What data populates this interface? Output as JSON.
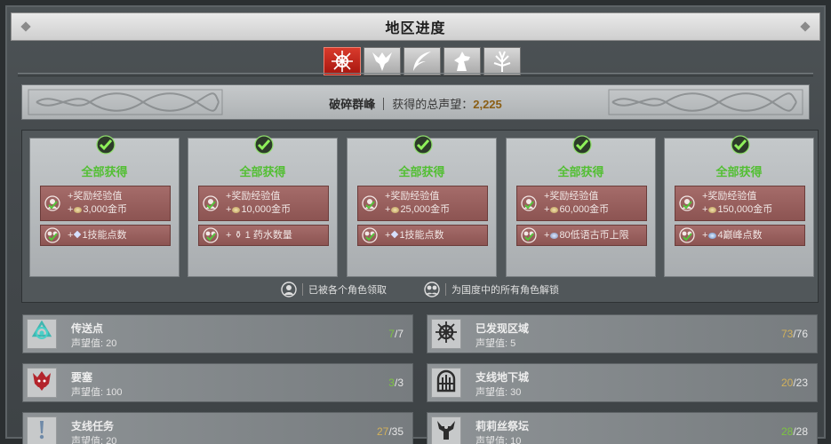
{
  "window": {
    "title": "地区进度"
  },
  "tabs": [
    {
      "icon": "sun-cross-icon",
      "active": true
    },
    {
      "icon": "dragon-head-icon",
      "active": false
    },
    {
      "icon": "feather-icon",
      "active": false
    },
    {
      "icon": "horse-icon",
      "active": false
    },
    {
      "icon": "tree-icon",
      "active": false
    }
  ],
  "header": {
    "region": "破碎群峰",
    "label": "获得的总声望：",
    "amount": "2,225"
  },
  "reward_tiers": [
    {
      "status": "全部获得",
      "xp_line": "+奖励经验值",
      "gold_plus": "+",
      "gold": "3,000金币",
      "extra_plus": "+",
      "extra": "1技能点数",
      "extra_icon": "skill"
    },
    {
      "status": "全部获得",
      "xp_line": "+奖励经验值",
      "gold_plus": "+",
      "gold": "10,000金币",
      "extra_plus": "+",
      "extra": "1 药水数量",
      "extra_icon": "potion"
    },
    {
      "status": "全部获得",
      "xp_line": "+奖励经验值",
      "gold_plus": "+",
      "gold": "25,000金币",
      "extra_plus": "+",
      "extra": "1技能点数",
      "extra_icon": "skill"
    },
    {
      "status": "全部获得",
      "xp_line": "+奖励经验值",
      "gold_plus": "+",
      "gold": "60,000金币",
      "extra_plus": "+",
      "extra": "80低语古币上限",
      "extra_icon": "obol"
    },
    {
      "status": "全部获得",
      "xp_line": "+奖励经验值",
      "gold_plus": "+",
      "gold": "150,000金币",
      "extra_plus": "+",
      "extra": "4巅峰点数",
      "extra_icon": "paragon"
    }
  ],
  "legend": {
    "character_claimed": "已被各个角色领取",
    "realm_unlocked": "为国度中的所有角色解锁"
  },
  "progress": [
    {
      "title": "传送点",
      "rep_label": "声望值:",
      "rep": "20",
      "current": "7",
      "max": "/7",
      "complete": true,
      "icon": "waypoint-icon"
    },
    {
      "title": "已发现区域",
      "rep_label": "声望值:",
      "rep": "5",
      "current": "73",
      "max": "/76",
      "complete": false,
      "icon": "compass-icon"
    },
    {
      "title": "要塞",
      "rep_label": "声望值:",
      "rep": "100",
      "current": "3",
      "max": "/3",
      "complete": true,
      "icon": "stronghold-icon"
    },
    {
      "title": "支线地下城",
      "rep_label": "声望值:",
      "rep": "30",
      "current": "20",
      "max": "/23",
      "complete": false,
      "icon": "dungeon-gate-icon"
    },
    {
      "title": "支线任务",
      "rep_label": "声望值:",
      "rep": "20",
      "current": "27",
      "max": "/35",
      "complete": false,
      "icon": "exclamation-icon"
    },
    {
      "title": "莉莉丝祭坛",
      "rep_label": "声望值:",
      "rep": "10",
      "current": "28",
      "max": "/28",
      "complete": true,
      "icon": "lilith-altar-icon"
    }
  ],
  "colors": {
    "complete": "#7cc440",
    "partial": "#d2b15b",
    "active_tab": "#c0241a",
    "reward_box": "#9a605e"
  }
}
